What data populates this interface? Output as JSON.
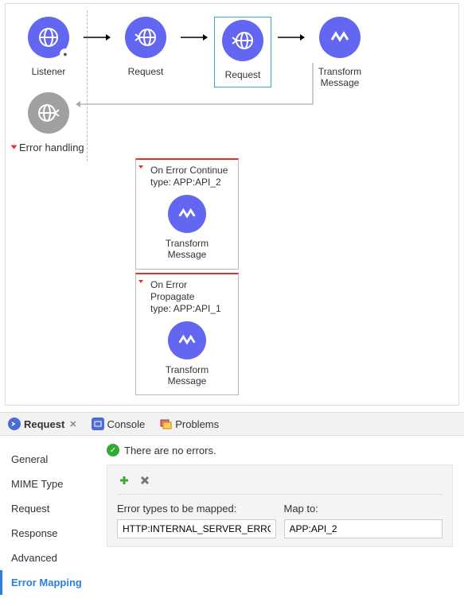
{
  "flow": {
    "nodes": [
      {
        "key": "listener",
        "label": "Listener",
        "icon": "globe",
        "hasBadge": true
      },
      {
        "key": "request1",
        "label": "Request",
        "icon": "globe-arrow"
      },
      {
        "key": "request2",
        "label": "Request",
        "icon": "globe-arrow",
        "selected": true
      },
      {
        "key": "transform",
        "label": "Transform\nMessage",
        "icon": "wave"
      }
    ],
    "returnIcon": "globe-arrow-grey"
  },
  "errorHandling": {
    "title": "Error handling",
    "handlers": [
      {
        "title": "On Error Continue",
        "type": "type: APP:API_2",
        "innerLabel": "Transform\nMessage"
      },
      {
        "title": "On Error Propagate",
        "type": "type: APP:API_1",
        "innerLabel": "Transform\nMessage"
      }
    ]
  },
  "tabs": {
    "items": [
      {
        "key": "request",
        "label": "Request",
        "active": true,
        "closable": true,
        "icon": "http"
      },
      {
        "key": "console",
        "label": "Console",
        "icon": "console"
      },
      {
        "key": "problems",
        "label": "Problems",
        "icon": "problems"
      }
    ]
  },
  "sideNav": {
    "items": [
      {
        "label": "General"
      },
      {
        "label": "MIME Type"
      },
      {
        "label": "Request"
      },
      {
        "label": "Response"
      },
      {
        "label": "Advanced"
      },
      {
        "label": "Error Mapping",
        "active": true
      }
    ]
  },
  "panel": {
    "status": "There are no errors.",
    "columns": {
      "left": "Error types to be mapped:",
      "right": "Map to:"
    },
    "row": {
      "errorType": "HTTP:INTERNAL_SERVER_ERROR",
      "mapTo": "APP:API_2"
    }
  }
}
